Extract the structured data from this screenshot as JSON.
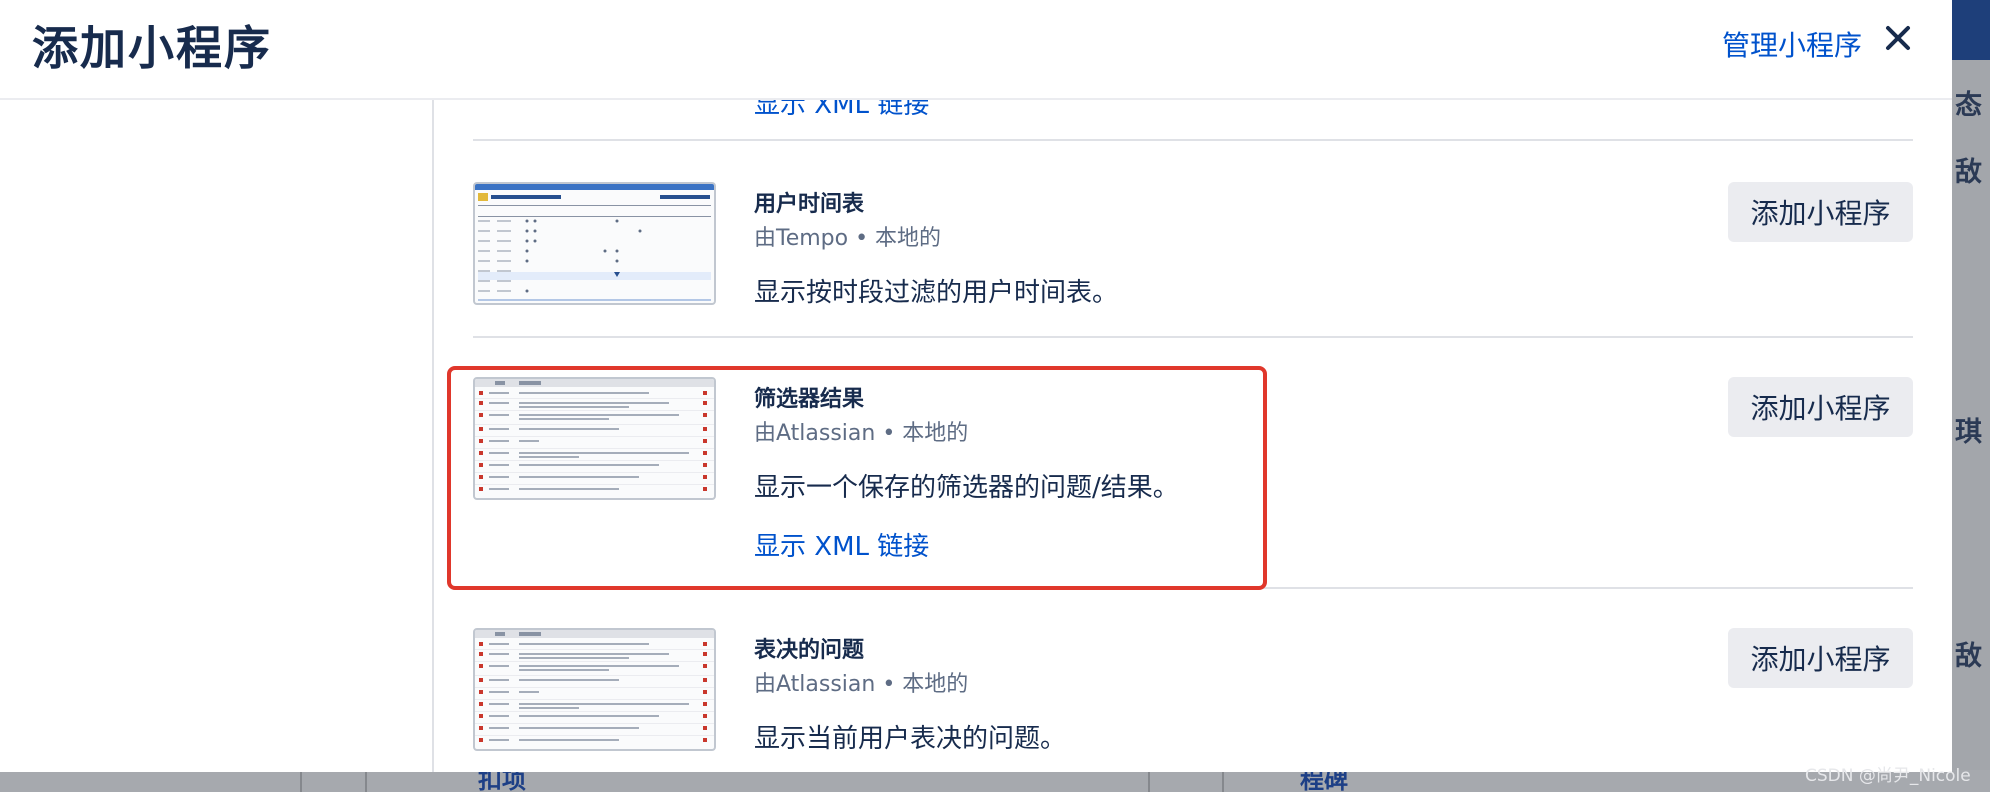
{
  "modal": {
    "title": "添加小程序",
    "manage_link": "管理小程序",
    "close_icon": "close-icon"
  },
  "partial_top_item": {
    "xml_link": "显示 XML 链接"
  },
  "gadgets": [
    {
      "name": "用户时间表",
      "meta": "由Tempo • 本地的",
      "description": "显示按时段过滤的用户时间表。",
      "xml_link": "",
      "button": "添加小程序",
      "thumbnail": "timesheet-thumbnail"
    },
    {
      "name": "筛选器结果",
      "meta": "由Atlassian • 本地的",
      "description": "显示一个保存的筛选器的问题/结果。",
      "xml_link": "显示 XML 链接",
      "button": "添加小程序",
      "thumbnail": "issue-list-thumbnail",
      "highlighted": true
    },
    {
      "name": "表决的问题",
      "meta": "由Atlassian • 本地的",
      "description": "显示当前用户表决的问题。",
      "xml_link": "",
      "button": "添加小程序",
      "thumbnail": "issue-list-thumbnail"
    }
  ],
  "background": {
    "fragments": [
      "态",
      "敌",
      "琪",
      "敌"
    ],
    "bottom_links": [
      "扣项",
      "程碑"
    ],
    "watermark": "CSDN @尚尹_Nicole"
  },
  "colors": {
    "link": "#0052cc",
    "highlight": "#e0372b",
    "button_bg": "#ebecf0",
    "text": "#172b4d",
    "meta": "#5e6c84"
  }
}
